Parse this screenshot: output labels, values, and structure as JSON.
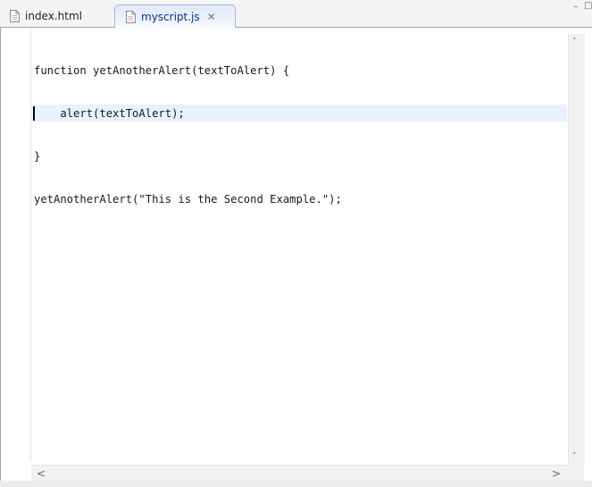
{
  "tabs": [
    {
      "label": "index.html",
      "icon": "html-file-icon",
      "active": false
    },
    {
      "label": "myscript.js",
      "icon": "js-file-icon",
      "active": true,
      "close_glyph": "✕"
    }
  ],
  "window_controls": {
    "minimize": "–",
    "maximize": "□"
  },
  "editor": {
    "code_lines": [
      "function yetAnotherAlert(textToAlert) {",
      "    alert(textToAlert);",
      "}",
      "yetAnotherAlert(\"This is the Second Example.\");"
    ],
    "current_line": 5
  },
  "scrollbars": {
    "up": "˄",
    "down": "˅",
    "left": "<",
    "right": ">"
  },
  "colors": {
    "current_line": "#e8f2fe",
    "active_tab_text": "#0b2f96",
    "caret": "#000000"
  }
}
